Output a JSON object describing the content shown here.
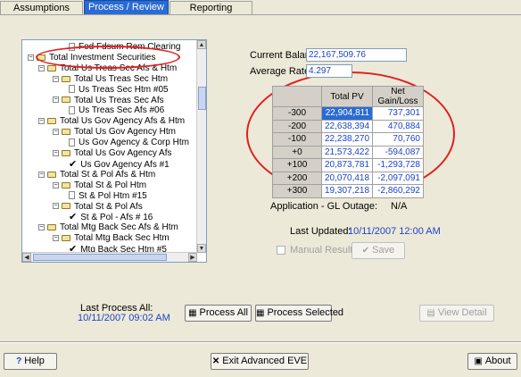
{
  "tabs": [
    {
      "label": "Assumptions"
    },
    {
      "label": "Process / Review"
    },
    {
      "label": "Reporting"
    }
  ],
  "tree": [
    {
      "label": "Fed Fdsum Rem Clearing",
      "kind": "doc",
      "indent": 3
    },
    {
      "label": "Total Investment Securities",
      "kind": "folder",
      "indent": 0
    },
    {
      "label": "Total Us Treas Sec   Afs & Htm",
      "kind": "folder",
      "indent": 1
    },
    {
      "label": "Total Us Treas Sec      Htm",
      "kind": "folder",
      "indent": 2
    },
    {
      "label": "Us Treas Sec         Htm #05",
      "kind": "doc",
      "indent": 3
    },
    {
      "label": "Total Us Treas Sec      Afs",
      "kind": "folder",
      "indent": 2
    },
    {
      "label": "Us Treas Sec         Afs #06",
      "kind": "doc",
      "indent": 3
    },
    {
      "label": "Total Us Gov Agency   Afs & Htm",
      "kind": "folder",
      "indent": 1
    },
    {
      "label": "Total Us Gov Agency    Htm",
      "kind": "folder",
      "indent": 2
    },
    {
      "label": "Us Gov Agency & Corp   Htm",
      "kind": "doc",
      "indent": 3
    },
    {
      "label": "Total Us Gov Agency    Afs",
      "kind": "folder",
      "indent": 2
    },
    {
      "label": "Us Gov Agency       Afs #1",
      "kind": "check",
      "indent": 3
    },
    {
      "label": "Total St & Pol     Afs & Htm",
      "kind": "folder",
      "indent": 1
    },
    {
      "label": "Total St & Pol       Htm",
      "kind": "folder",
      "indent": 2
    },
    {
      "label": "St & Pol           Htm #15",
      "kind": "doc",
      "indent": 3
    },
    {
      "label": "Total St & Pol       Afs",
      "kind": "folder",
      "indent": 2
    },
    {
      "label": "St & Pol -          Afs # 16",
      "kind": "check",
      "indent": 3
    },
    {
      "label": "Total Mtg Back Sec  Afs & Htm",
      "kind": "folder",
      "indent": 1
    },
    {
      "label": "Total Mtg Back Sec     Htm",
      "kind": "folder",
      "indent": 2
    },
    {
      "label": "Mtg Back Sec        Htm #5",
      "kind": "check",
      "indent": 3
    }
  ],
  "balance": {
    "label": "Current Balance:",
    "value": "22,167,509.76"
  },
  "rate": {
    "label": "Average Rate:",
    "value": "4.297"
  },
  "table": {
    "headers": [
      "",
      "Total PV",
      "Net Gain/Loss"
    ],
    "rows": [
      {
        "shift": "-300",
        "pv": "22,904,811",
        "gain": "737,301"
      },
      {
        "shift": "-200",
        "pv": "22,638,394",
        "gain": "470,884"
      },
      {
        "shift": "-100",
        "pv": "22,238,270",
        "gain": "70,760"
      },
      {
        "shift": "+0",
        "pv": "21,573,422",
        "gain": "-594,087"
      },
      {
        "shift": "+100",
        "pv": "20,873,781",
        "gain": "-1,293,728"
      },
      {
        "shift": "+200",
        "pv": "20,070,418",
        "gain": "-2,097,091"
      },
      {
        "shift": "+300",
        "pv": "19,307,218",
        "gain": "-2,860,292"
      }
    ]
  },
  "application": {
    "label": "Application - GL Outage:",
    "value": "N/A"
  },
  "last_updated": {
    "label": "Last Updated:",
    "value": "10/11/2007 12:00 AM"
  },
  "manual_results": "Manual Results",
  "save_label": "Save",
  "last_process": {
    "label": "Last Process All:",
    "value": "10/11/2007 09:02 AM"
  },
  "process_all_label": "Process All",
  "process_selected_label": "Process Selected",
  "view_detail_label": "View Detail",
  "help_label": "Help",
  "exit_label": "Exit Advanced EVE",
  "about_label": "About"
}
